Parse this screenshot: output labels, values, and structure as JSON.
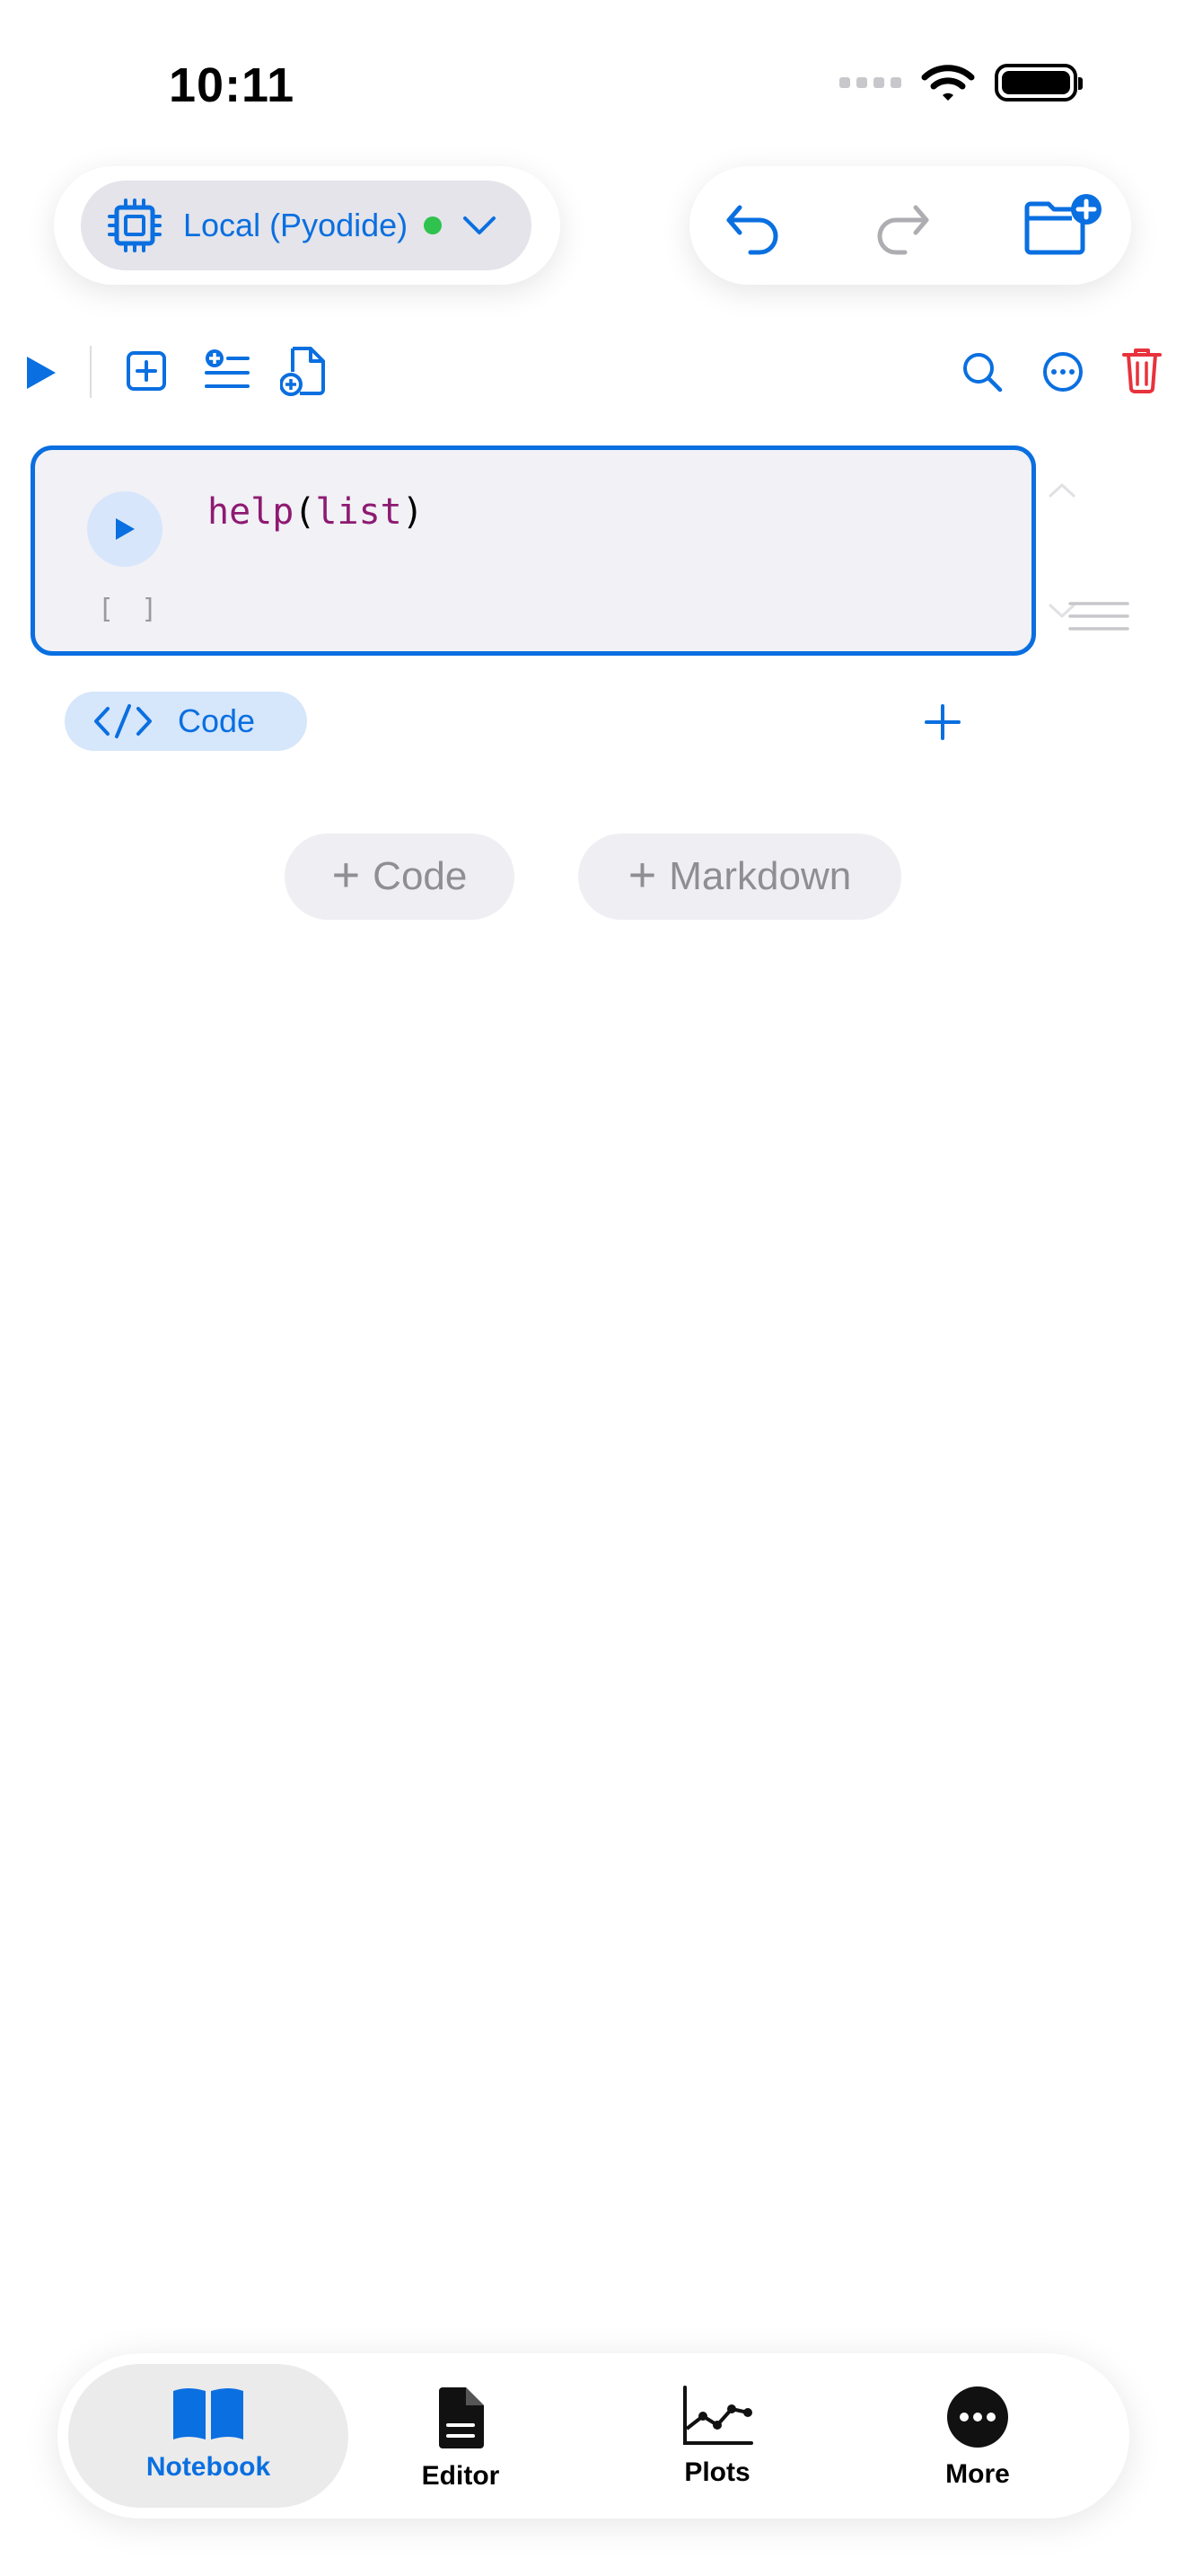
{
  "status_bar": {
    "time": "10:11"
  },
  "kernel": {
    "label": "Local (Pyodide)",
    "status_color": "#30c24e",
    "icon": "cpu-chip-icon"
  },
  "header_actions": {
    "undo_icon": "undo-icon",
    "redo_icon": "redo-icon",
    "new_folder_icon": "folder-plus-icon"
  },
  "toolbar": {
    "left_icons": [
      "run-all-icon",
      "add-cell-icon",
      "insert-below-icon",
      "new-file-icon"
    ],
    "right_icons": [
      "search-icon",
      "ellipsis-circle-icon",
      "trash-icon"
    ]
  },
  "cell": {
    "code_fn": "help",
    "code_open": "(",
    "code_arg": "list",
    "code_close": ")",
    "execution_count": "[ ]",
    "type_label": "Code"
  },
  "add_buttons": {
    "code": "Code",
    "markdown": "Markdown"
  },
  "tabs": [
    {
      "label": "Notebook",
      "icon": "book-icon",
      "active": true
    },
    {
      "label": "Editor",
      "icon": "document-icon",
      "active": false
    },
    {
      "label": "Plots",
      "icon": "line-chart-icon",
      "active": false
    },
    {
      "label": "More",
      "icon": "ellipsis-icon",
      "active": false
    }
  ],
  "colors": {
    "accent": "#0a6fe0",
    "destructive": "#e8323c",
    "disabled": "#aeaeb2"
  }
}
